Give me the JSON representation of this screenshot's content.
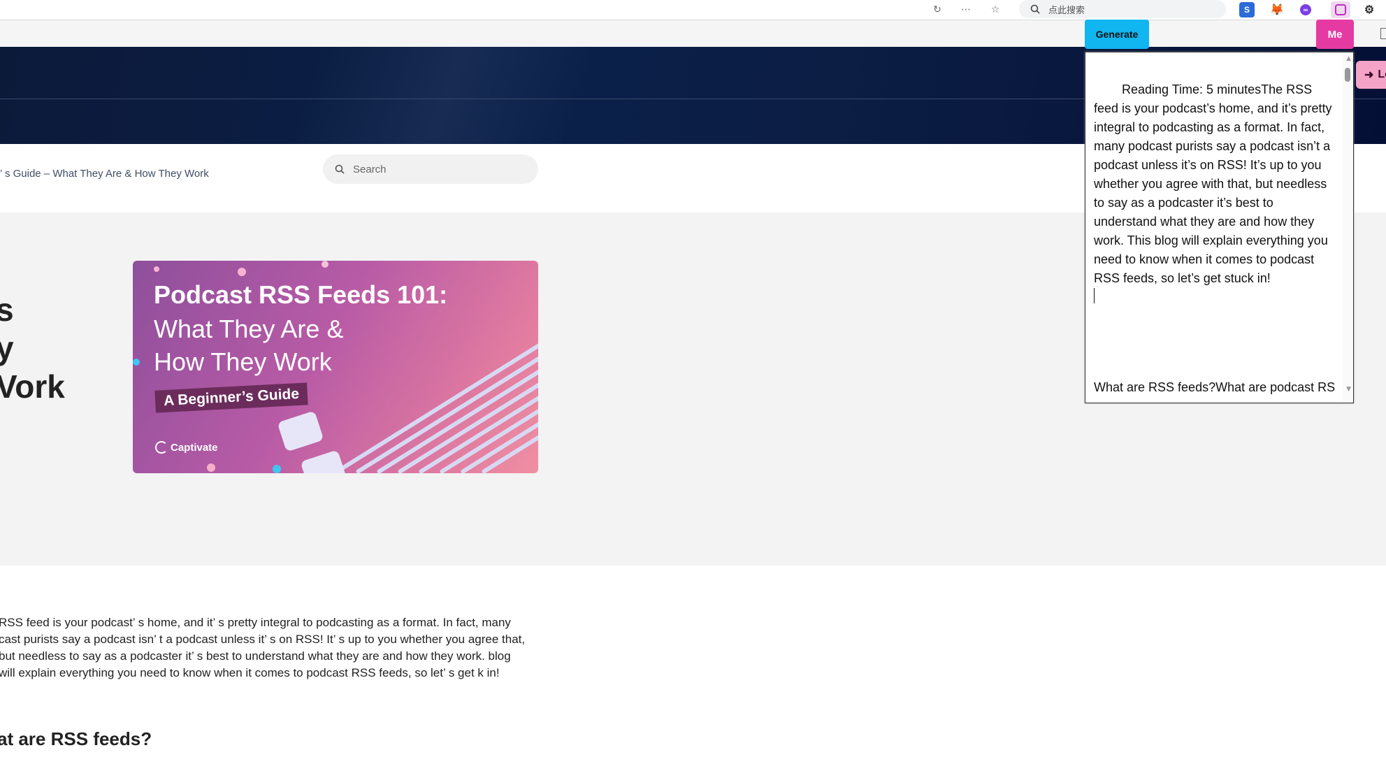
{
  "browser": {
    "search_placeholder": "点此搜索",
    "extensions": [
      "s-ext-icon",
      "metamask-icon",
      "purple-ext-icon",
      "chat-ext-icon",
      "puzzle-icon"
    ]
  },
  "site": {
    "breadcrumb": "’ s Guide – What They Are & How They Work",
    "search_placeholder": "Search",
    "login_label": "Lo",
    "title_fragment_lines": [
      "s",
      "y",
      "Vork"
    ],
    "cover": {
      "heading": "Podcast RSS Feeds 101:",
      "subheading_1": "What They Are &",
      "subheading_2": "How They Work",
      "badge": "A Beginner’s Guide",
      "brand": "Captivate"
    },
    "body_text": "RSS feed is your podcast’ s home, and it’ s pretty integral to podcasting as a format. In fact, many cast purists say a podcast isn’ t a podcast unless it’ s on RSS! It’ s up to you whether you agree that, but needless to say as a podcaster it’ s best to understand what they are and how they work. blog will explain everything you need to know when it comes to podcast RSS feeds, so let’ s get k in!",
    "heading_2": "at are RSS feeds?"
  },
  "extension": {
    "generate_label": "Generate",
    "me_label": "Me",
    "output_text": "Reading Time:  5 minutesThe RSS feed is your podcast’s home, and it’s pretty integral to podcasting as a format. In fact, many podcast purists say a podcast isn’t a podcast unless it’s on RSS! It’s up to you whether you agree with that, but needless to say as a podcaster it’s best to understand what they are and how they work. This blog will explain everything you need to know when it comes to podcast RSS feeds, so let’s get stuck in!",
    "output_footer": "What are RSS feeds?What are podcast RSS",
    "colors": {
      "generate": "#11b5f0",
      "me": "#e63aa3"
    }
  }
}
